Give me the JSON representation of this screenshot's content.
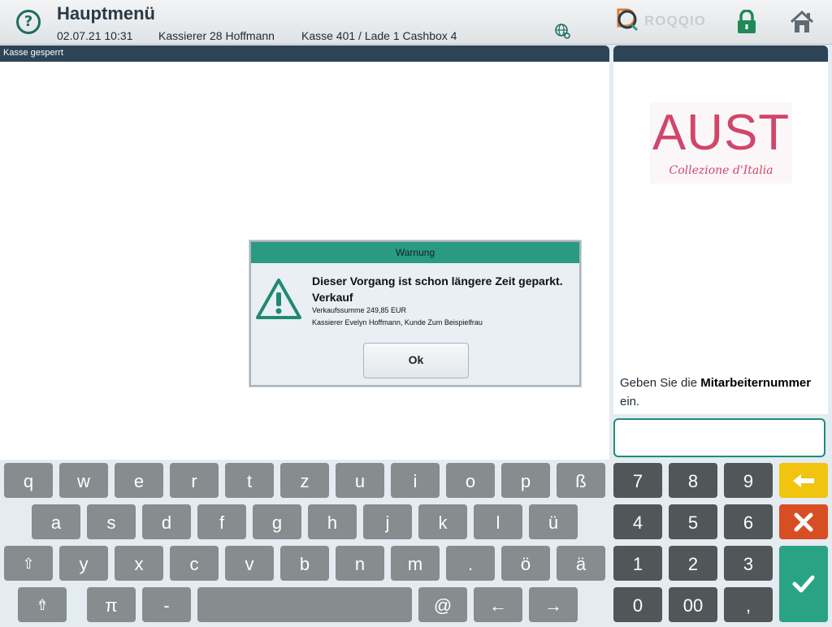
{
  "header": {
    "title": "Hauptmenü",
    "date_time": "02.07.21  10:31",
    "cashier": "Kassierer 28 Hoffmann",
    "register": "Kasse 401 / Lade 1 Cashbox 4",
    "help_glyph": "?",
    "icons": [
      "help-icon",
      "network-globe-icon",
      "lock-icon",
      "home-icon"
    ],
    "brand_logo": "ROQQIO"
  },
  "left_panel": {
    "bar_label": "Kasse gesperrt"
  },
  "right_panel": {
    "logo_main": "AUST",
    "logo_sub": "Collezione d'Italia",
    "prompt_pre": "Geben Sie die ",
    "prompt_bold": "Mitarbeiternummer",
    "prompt_post": "ein.",
    "input_value": ""
  },
  "dialog": {
    "title": "Warnung",
    "line1": "Dieser Vorgang ist schon längere Zeit geparkt.",
    "line2": "Verkauf",
    "line3": "Verkaufssumme 249,85 EUR",
    "line4": "Kassierer Evelyn Hoffmann, Kunde Zum Beispielfrau",
    "ok_label": "Ok",
    "icon": "warning-triangle-icon"
  },
  "keyboard": {
    "row1": [
      "q",
      "w",
      "e",
      "r",
      "t",
      "z",
      "u",
      "i",
      "o",
      "p",
      "ß"
    ],
    "row2": [
      "a",
      "s",
      "d",
      "f",
      "g",
      "h",
      "j",
      "k",
      "l",
      "ü"
    ],
    "row3": [
      "y",
      "x",
      "c",
      "v",
      "b",
      "n",
      "m",
      ".",
      "ö",
      "ä"
    ],
    "shift": "⇧",
    "capslock": "⇮",
    "pi": "π",
    "dash": "-",
    "at": "@",
    "left": "←",
    "right": "→",
    "numpad": [
      "7",
      "8",
      "9",
      "4",
      "5",
      "6",
      "1",
      "2",
      "3",
      "0",
      "00",
      ","
    ],
    "action_icons": [
      "backspace-arrow-icon",
      "clear-x-icon",
      "confirm-check-icon"
    ]
  },
  "colors": {
    "accent": "#2a9a81",
    "dark_bar": "#2d4457",
    "key_gray": "#858d8e",
    "num_key": "#4f5759",
    "yellow": "#f1c40f",
    "red": "#d84e24",
    "green": "#2aa385",
    "aust_pink": "#d1466b"
  }
}
